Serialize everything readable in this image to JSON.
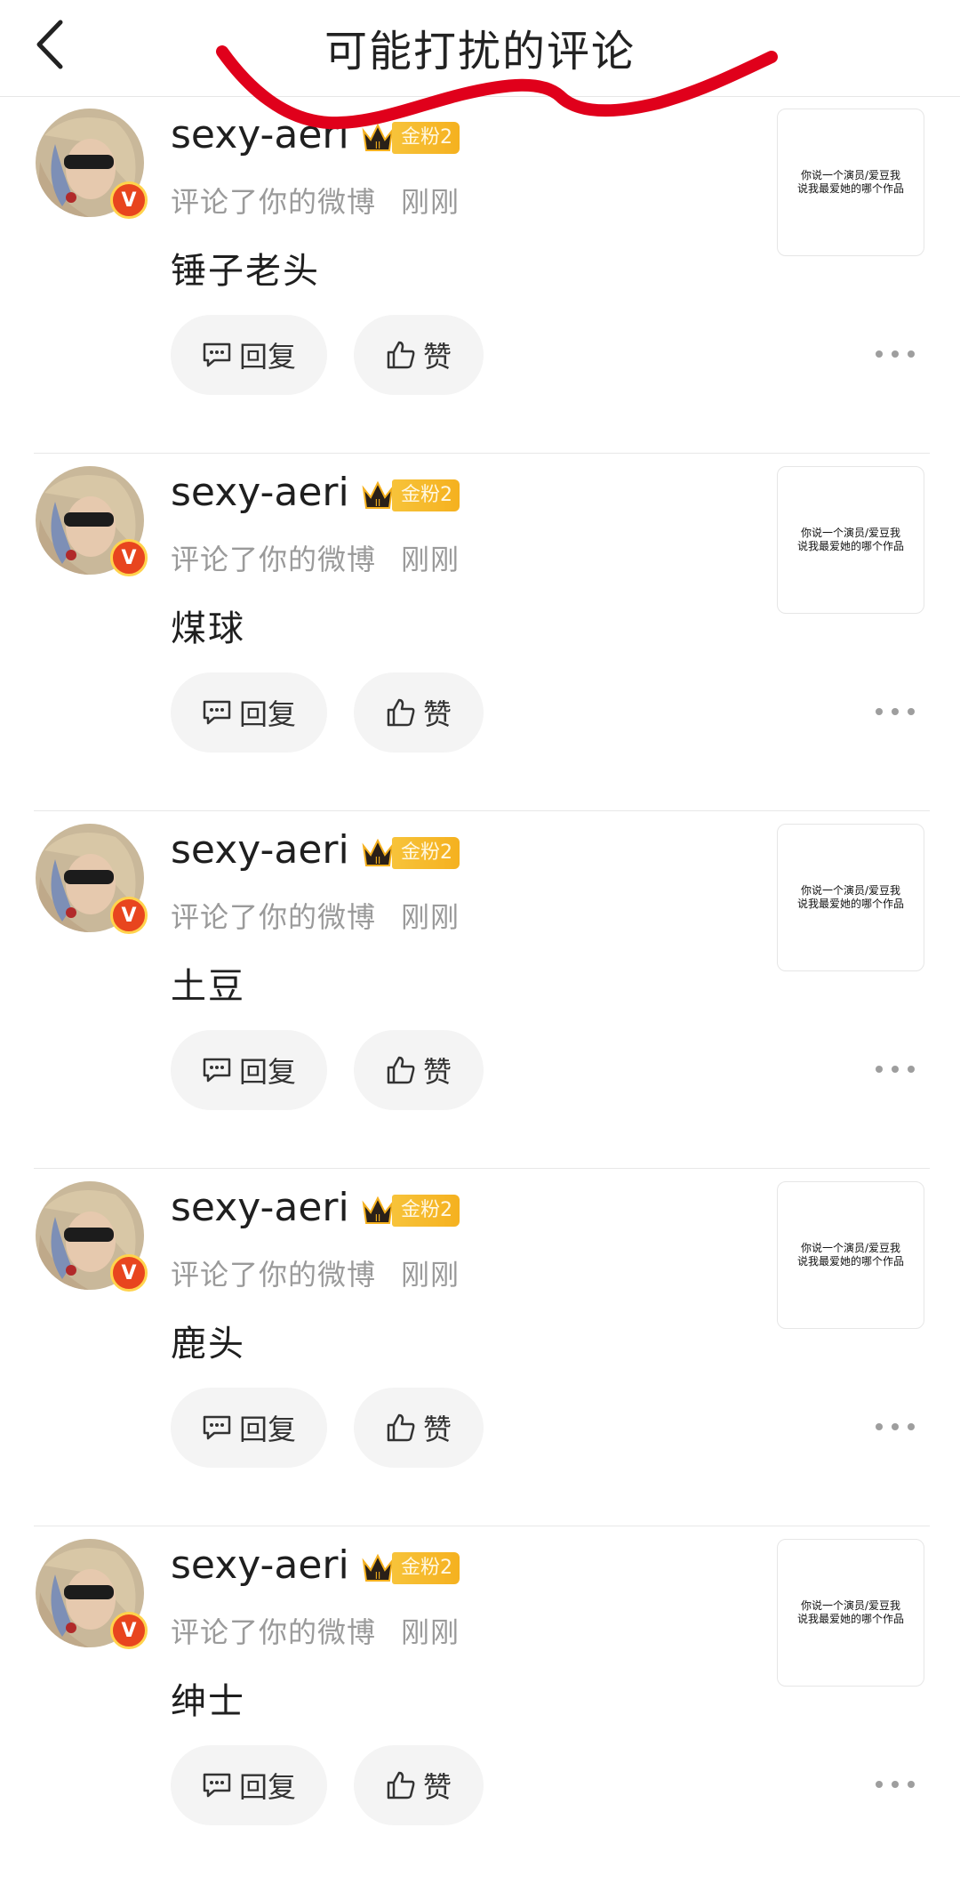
{
  "header": {
    "title": "可能打扰的评论"
  },
  "colors": {
    "annotation_red": "#e0001b",
    "fan_badge": "#f5b11f",
    "verified": "#e8451e"
  },
  "icons": {
    "back": "chevron-left-icon",
    "reply": "comment-icon",
    "like": "thumbs-up-icon",
    "more": "more-dots-icon",
    "crown": "crown-icon",
    "verified": "verified-v-icon"
  },
  "comments": [
    {
      "username": "sexy-aeri",
      "badge": "金粉2",
      "badge_level": "II",
      "verified": "V",
      "action": "评论了你的微博",
      "time": "刚刚",
      "text": "锤子老头",
      "reply_label": "回复",
      "like_label": "赞",
      "thumb_text": "你说一个演员/爱豆我说我最爱她的哪个作品"
    },
    {
      "username": "sexy-aeri",
      "badge": "金粉2",
      "badge_level": "II",
      "verified": "V",
      "action": "评论了你的微博",
      "time": "刚刚",
      "text": "煤球",
      "reply_label": "回复",
      "like_label": "赞",
      "thumb_text": "你说一个演员/爱豆我说我最爱她的哪个作品"
    },
    {
      "username": "sexy-aeri",
      "badge": "金粉2",
      "badge_level": "II",
      "verified": "V",
      "action": "评论了你的微博",
      "time": "刚刚",
      "text": "土豆",
      "reply_label": "回复",
      "like_label": "赞",
      "thumb_text": "你说一个演员/爱豆我说我最爱她的哪个作品"
    },
    {
      "username": "sexy-aeri",
      "badge": "金粉2",
      "badge_level": "II",
      "verified": "V",
      "action": "评论了你的微博",
      "time": "刚刚",
      "text": "鹿头",
      "reply_label": "回复",
      "like_label": "赞",
      "thumb_text": "你说一个演员/爱豆我说我最爱她的哪个作品"
    },
    {
      "username": "sexy-aeri",
      "badge": "金粉2",
      "badge_level": "II",
      "verified": "V",
      "action": "评论了你的微博",
      "time": "刚刚",
      "text": "绅士",
      "reply_label": "回复",
      "like_label": "赞",
      "thumb_text": "你说一个演员/爱豆我说我最爱她的哪个作品"
    }
  ]
}
